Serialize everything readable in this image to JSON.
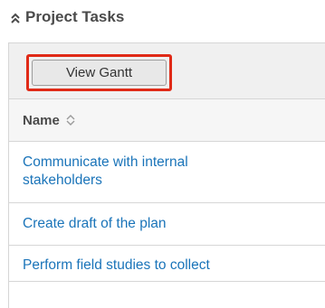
{
  "section": {
    "title": "Project Tasks",
    "icon": "double-chevron-up-icon"
  },
  "toolbar": {
    "view_gantt_label": "View Gantt",
    "highlight_color": "#e02a17"
  },
  "table": {
    "column_name": "Name",
    "sort_icon": "sort-arrows-icon",
    "rows": [
      {
        "name": "Communicate with internal stakeholders"
      },
      {
        "name": "Create draft of the plan"
      },
      {
        "name": "Perform field studies to collect"
      }
    ]
  },
  "colors": {
    "link": "#1a74b9",
    "header_text": "#4a4a4a"
  }
}
